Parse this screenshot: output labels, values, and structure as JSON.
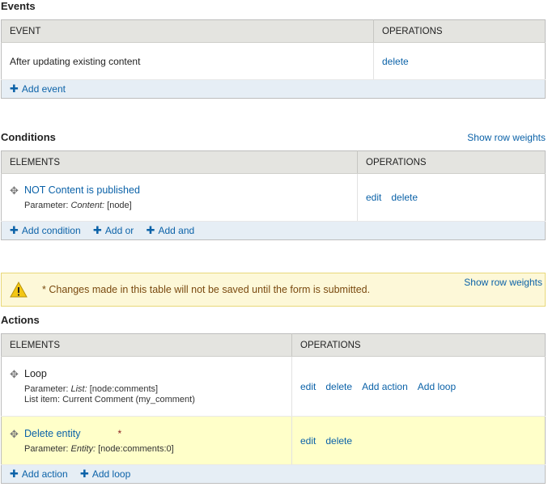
{
  "events": {
    "title": "Events",
    "col_event": "EVENT",
    "col_operations": "OPERATIONS",
    "rows": [
      {
        "label": "After updating existing content",
        "ops": [
          "delete"
        ]
      }
    ],
    "footer": [
      "Add event"
    ]
  },
  "conditions": {
    "title": "Conditions",
    "show_row_weights": "Show row weights",
    "col_elements": "ELEMENTS",
    "col_operations": "OPERATIONS",
    "rows": [
      {
        "label": "NOT Content is published",
        "param_prefix": "Parameter:",
        "param_name": "Content:",
        "param_value": "[node]",
        "ops": [
          "edit",
          "delete"
        ]
      }
    ],
    "footer": [
      "Add condition",
      "Add or",
      "Add and"
    ]
  },
  "warning": {
    "message": "* Changes made in this table will not be saved until the form is submitted.",
    "show_row_weights": "Show row weights",
    "color": "#fdf8d8"
  },
  "actions": {
    "title": "Actions",
    "col_elements": "ELEMENTS",
    "col_operations": "OPERATIONS",
    "rows": [
      {
        "label": "Loop",
        "param_prefix": "Parameter:",
        "param_name": "List:",
        "param_value": "[node:comments]",
        "param2": "List item: Current Comment (my_comment)",
        "ops": [
          "edit",
          "delete",
          "Add action",
          "Add loop"
        ]
      },
      {
        "label": "Delete entity",
        "changed_marker": "*",
        "param_prefix": "Parameter:",
        "param_name": "Entity:",
        "param_value": "[node:comments:0]",
        "ops": [
          "edit",
          "delete"
        ]
      }
    ],
    "footer": [
      "Add action",
      "Add loop"
    ]
  },
  "icons": {
    "drag": "drag-handle-icon",
    "plus": "plus-icon",
    "warning": "warning-icon"
  },
  "colors": {
    "link": "#0b62a8",
    "header_bg": "#e4e4e0",
    "footer_bg": "#e6eef5",
    "changed_row": "#ffffc9"
  }
}
